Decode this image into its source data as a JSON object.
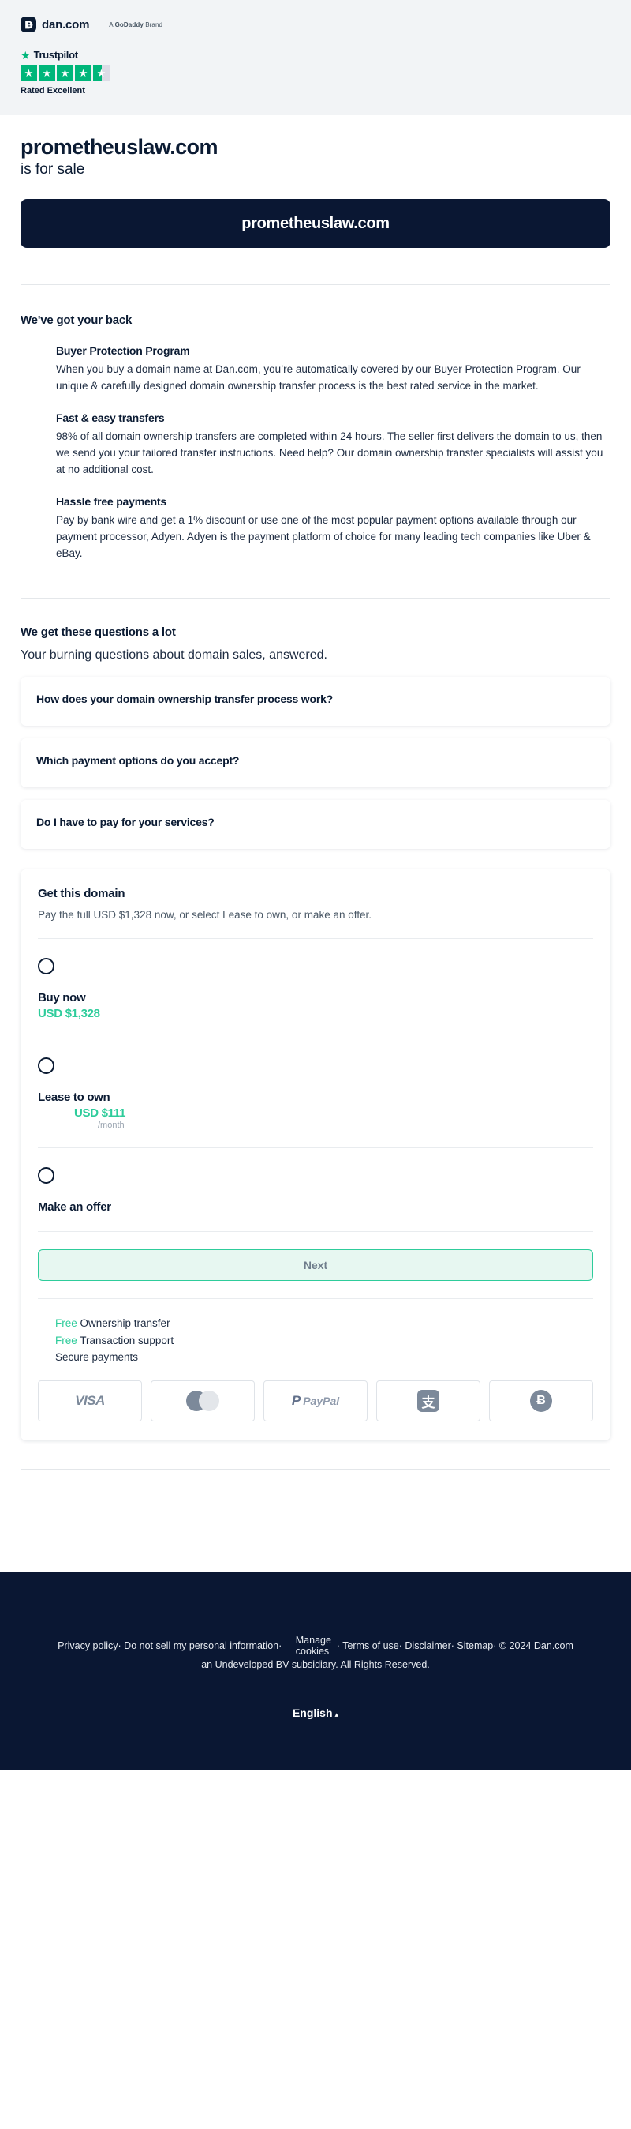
{
  "topbar": {
    "logo_word": "dan.com",
    "godaddy_prefix": "A ",
    "godaddy_brand": "GoDaddy",
    "godaddy_suffix": " Brand",
    "trustpilot_name": "Trustpilot",
    "trustpilot_rating_label": "Rated Excellent",
    "trustpilot_stars_full": 4,
    "trustpilot_stars_half": 1
  },
  "hero": {
    "domain": "prometheuslaw.com",
    "subtitle": "is for sale",
    "banner_domain": "prometheuslaw.com"
  },
  "back": {
    "heading": "We've got your back",
    "features": [
      {
        "title": "Buyer Protection Program",
        "body": "When you buy a domain name at Dan.com, you’re automatically covered by our Buyer Protection Program. Our unique & carefully designed domain ownership transfer process is the best rated service in the market."
      },
      {
        "title": "Fast & easy transfers",
        "body": "98% of all domain ownership transfers are completed within 24 hours. The seller first delivers the domain to us, then we send you your tailored transfer instructions. Need help? Our domain ownership transfer specialists will assist you at no additional cost."
      },
      {
        "title": "Hassle free payments",
        "body": "Pay by bank wire and get a 1% discount or use one of the most popular payment options available through our payment processor, Adyen. Adyen is the payment platform of choice for many leading tech companies like Uber & eBay."
      }
    ]
  },
  "faq": {
    "heading": "We get these questions a lot",
    "lead": "Your burning questions about domain sales, answered.",
    "items": [
      {
        "question": "How does your domain ownership transfer process work?"
      },
      {
        "question": "Which payment options do you accept?"
      },
      {
        "question": "Do I have to pay for your services?"
      }
    ]
  },
  "buybox": {
    "title": "Get this domain",
    "description": "Pay the full USD $1,328 now, or select Lease to own, or make an offer.",
    "options": [
      {
        "name": "Buy now",
        "price": "USD $1,328",
        "per": "",
        "selected": false
      },
      {
        "name": "Lease to own",
        "price": "USD $111",
        "per": "/month",
        "selected": false
      },
      {
        "name": "Make an offer",
        "price": "",
        "per": "",
        "selected": false
      }
    ],
    "next_label": "Next",
    "perks": [
      {
        "free_label": "Free",
        "text": " Ownership transfer"
      },
      {
        "free_label": "Free",
        "text": " Transaction support"
      },
      {
        "free_label": "",
        "text": "Secure payments"
      }
    ],
    "cards": [
      {
        "name": "visa-card-logo",
        "label": "VISA"
      },
      {
        "name": "mastercard-card-logo",
        "label": "Mastercard"
      },
      {
        "name": "paypal-card-logo",
        "label": "PayPal",
        "mark": "P",
        "text": "PayPal"
      },
      {
        "name": "alipay-card-logo",
        "label": "Alipay",
        "glyph": "支"
      },
      {
        "name": "bitcoin-card-logo",
        "label": "Bitcoin",
        "glyph": "Ƀ"
      }
    ]
  },
  "footer": {
    "privacy": "Privacy policy",
    "do_not_sell": "Do not sell my personal information",
    "manage_cookies": "Manage cookies",
    "terms": "Terms of use",
    "disclaimer": "Disclaimer",
    "sitemap": "Sitemap",
    "copyright": "© 2024 Dan.com",
    "subsidiary": "an Undeveloped BV subsidiary. All Rights Reserved.",
    "sep": "·",
    "language": "English",
    "caret": "▴"
  },
  "colors": {
    "dark": "#0a1733",
    "green": "#2ecc9b",
    "trustpilot_green": "#00b67a"
  }
}
